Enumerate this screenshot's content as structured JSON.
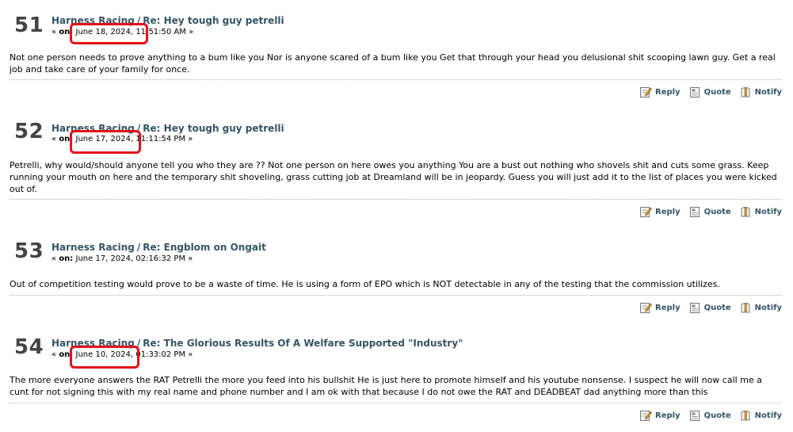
{
  "posts": [
    {
      "counter": "51",
      "board": "Harness Racing",
      "separator": "/",
      "subject": "Re: Hey tough guy petrelli",
      "prefix": "«",
      "on_label": "on:",
      "date": "June 18, 2024, 11:51:50 AM",
      "suffix": "»",
      "body": "Not one person needs to prove anything to a bum like you   Nor is anyone scared of a bum like you    Get that through your head you delusional shit scooping lawn guy.  Get a real job and take care of your family for once.",
      "highlighted": true
    },
    {
      "counter": "52",
      "board": "Harness Racing",
      "separator": "/",
      "subject": "Re: Hey tough guy petrelli",
      "prefix": "«",
      "on_label": "on:",
      "date": "June 17, 2024, 11:11:54 PM",
      "suffix": "»",
      "body": "Petrelli, why would/should anyone tell you who they are ??    Not one person on here owes you anything   You are a bust out nothing  who shovels shit and cuts some grass.   Keep running your mouth on here and the temporary shit shoveling, grass cutting job at Dreamland will be in jeopardy.  Guess you will just add it to the list of places you were kicked out of.",
      "highlighted": true
    },
    {
      "counter": "53",
      "board": "Harness Racing",
      "separator": "/",
      "subject": "Re: Engblom on Ongait",
      "prefix": "«",
      "on_label": "on:",
      "date": "June 17, 2024, 02:16:32 PM",
      "suffix": "»",
      "body": "Out of competition testing would prove to be a waste of time.  He is using a form of EPO which is NOT detectable in any of the testing that the commission utilizes.",
      "highlighted": false
    },
    {
      "counter": "54",
      "board": "Harness Racing",
      "separator": "/",
      "subject": "Re: The Glorious Results Of A Welfare Supported \"Industry\"",
      "prefix": "«",
      "on_label": "on:",
      "date": "June 10, 2024, 01:33:02 PM",
      "suffix": "»",
      "body": "The more everyone answers the RAT Petrelli the more you feed into his bullshit    He is just here to promote himself and his youtube nonsense.  I suspect he will now call me a cunt for not signing this with my real name and phone number and I am ok with that because I do not owe the RAT and DEADBEAT dad anything more than this",
      "highlighted": true
    }
  ],
  "actions": {
    "reply": "Reply",
    "quote": "Quote",
    "notify": "Notify"
  },
  "icons": {
    "reply": "reply-icon",
    "quote": "quote-icon",
    "notify": "notify-icon"
  },
  "colors": {
    "link": "#335566",
    "highlight": "#e5101a",
    "counter": "#444444"
  }
}
